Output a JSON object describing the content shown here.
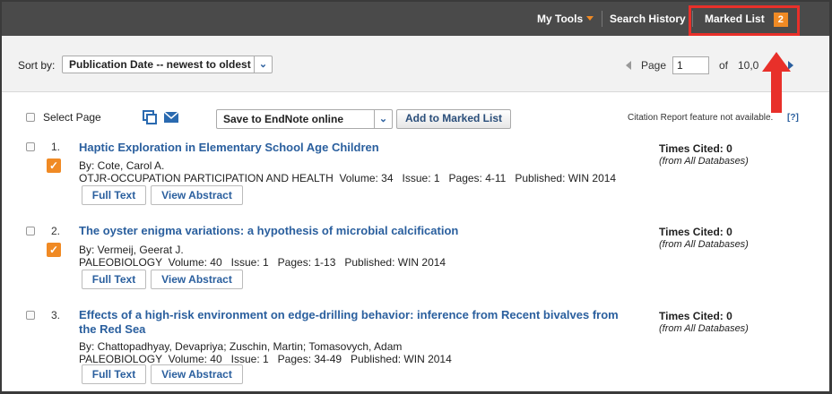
{
  "topbar": {
    "my_tools": "My Tools",
    "search_history": "Search History",
    "marked_list": "Marked List",
    "marked_count": "2"
  },
  "sort": {
    "label": "Sort by:",
    "selected": "Publication Date -- newest to oldest"
  },
  "pager": {
    "page_label": "Page",
    "page_value": "1",
    "of_label": "of",
    "total": "10,0"
  },
  "toolbar": {
    "select_page": "Select Page",
    "save_option": "Save to EndNote online",
    "add_marked": "Add to Marked List",
    "citation_note": "Citation Report feature not available.",
    "help": "[?]"
  },
  "results": [
    {
      "num": "1.",
      "title": "Haptic Exploration in Elementary School Age Children",
      "title2": "",
      "authors": "By: Cote, Carol A.",
      "source": "OTJR-OCCUPATION PARTICIPATION AND HEALTH  Volume: 34   Issue: 1   Pages: 4-11   Published: WIN 2014",
      "times_cited": "Times Cited: 0",
      "databases": "(from All Databases)",
      "full_text": "Full Text",
      "view_abstract": "View Abstract",
      "marked": true
    },
    {
      "num": "2.",
      "title": "The oyster enigma variations: a hypothesis of microbial calcification",
      "title2": "",
      "authors": "By: Vermeij, Geerat J.",
      "source": "PALEOBIOLOGY  Volume: 40   Issue: 1   Pages: 1-13   Published: WIN 2014",
      "times_cited": "Times Cited: 0",
      "databases": "(from All Databases)",
      "full_text": "Full Text",
      "view_abstract": "View Abstract",
      "marked": true
    },
    {
      "num": "3.",
      "title": "Effects of a high-risk environment on edge-drilling behavior: inference from Recent bivalves from",
      "title2": "the Red Sea",
      "authors": "By: Chattopadhyay, Devapriya; Zuschin, Martin; Tomasovych, Adam",
      "source": "PALEOBIOLOGY  Volume: 40   Issue: 1   Pages: 34-49   Published: WIN 2014",
      "times_cited": "Times Cited: 0",
      "databases": "(from All Databases)",
      "full_text": "Full Text",
      "view_abstract": "View Abstract",
      "marked": false
    }
  ],
  "colors": {
    "topbar": "#4a4a4a",
    "accent": "#f08a24",
    "link": "#2a5f9e",
    "highlight": "#e8302a"
  }
}
